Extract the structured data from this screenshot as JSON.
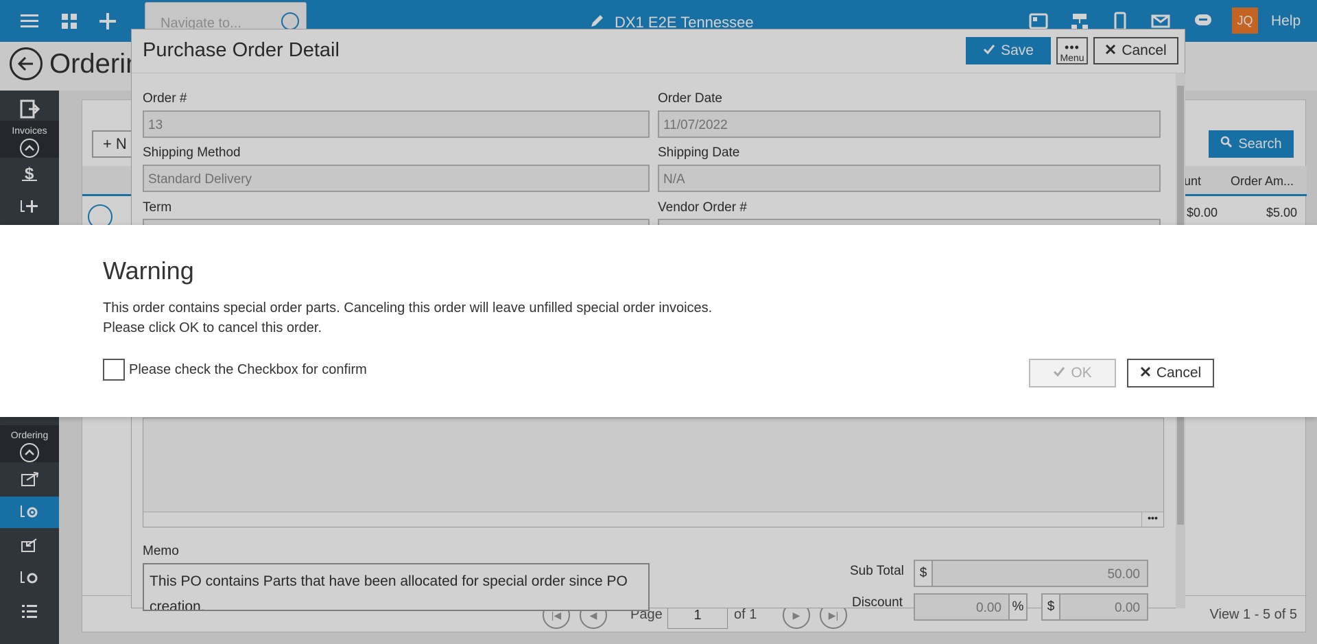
{
  "topbar": {
    "nav_placeholder": "Navigate to...",
    "app_title": "DX1 E2E Tennessee",
    "avatar_initials": "JQ",
    "help_label": "Help"
  },
  "page": {
    "title": "Ordering"
  },
  "sidebar": {
    "invoices_label": "Invoices",
    "ordering_label": "Ordering"
  },
  "background": {
    "new_label": "N",
    "search_label": "Search",
    "columns": [
      "unt",
      "Order Am..."
    ],
    "row": {
      "amount": "$0.00",
      "order_amount": "$5.00"
    },
    "pager": {
      "page_label": "Page",
      "page_value": "1",
      "of_label": "of 1",
      "view_count": "View 1 - 5 of 5"
    }
  },
  "po_modal": {
    "title": "Purchase Order Detail",
    "save_label": "Save",
    "menu_label": "Menu",
    "cancel_label": "Cancel",
    "fields": {
      "order_no": {
        "label": "Order #",
        "value": "13"
      },
      "order_date": {
        "label": "Order Date",
        "value": "11/07/2022"
      },
      "shipping_method": {
        "label": "Shipping Method",
        "value": "Standard Delivery"
      },
      "shipping_date": {
        "label": "Shipping Date",
        "value": "N/A"
      },
      "term": {
        "label": "Term"
      },
      "vendor_order": {
        "label": "Vendor Order #"
      }
    },
    "memo": {
      "label": "Memo",
      "value": "This PO contains Parts that have been allocated for special order since PO creation."
    },
    "summary": {
      "subtotal_label": "Sub Total",
      "currency": "$",
      "subtotal_value": "50.00",
      "discount_label": "Discount",
      "discount_pct_value": "0.00",
      "percent": "%",
      "discount_amt_value": "0.00"
    }
  },
  "warning": {
    "title": "Warning",
    "line1": "This order contains special order parts. Canceling this order will leave unfilled special order invoices.",
    "line2": "Please click OK to cancel this order.",
    "checkbox_label": "Please check the Checkbox for confirm",
    "ok_label": "OK",
    "cancel_label": "Cancel"
  },
  "colors": {
    "brand": "#1e88c7",
    "sidebar": "#3b4149",
    "avatar": "#f07a2a"
  }
}
